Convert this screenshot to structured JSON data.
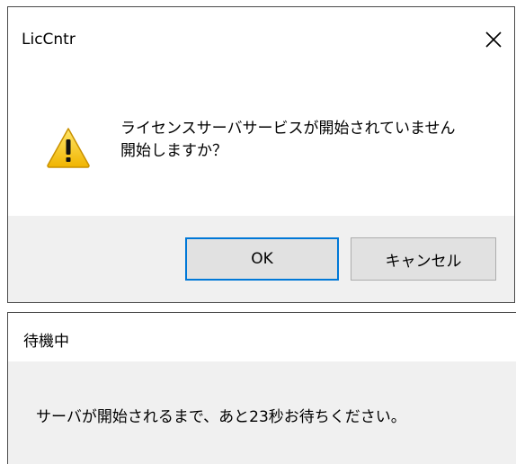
{
  "dialog1": {
    "title": "LicCntr",
    "close_icon": "close-icon",
    "warning_icon": "warning-icon",
    "message_line1": "ライセンスサーバサービスが開始されていません",
    "message_line2": "開始しますか？",
    "ok_label": "OK",
    "cancel_label": "キャンセル"
  },
  "dialog2": {
    "title": "待機中",
    "message": "サーバが開始されるまで、あと23秒お待ちください。"
  },
  "colors": {
    "footer_bg": "#f0f0f0",
    "button_bg": "#e1e1e1",
    "focus_border": "#0078d7",
    "warning_yellow": "#f3c300"
  }
}
